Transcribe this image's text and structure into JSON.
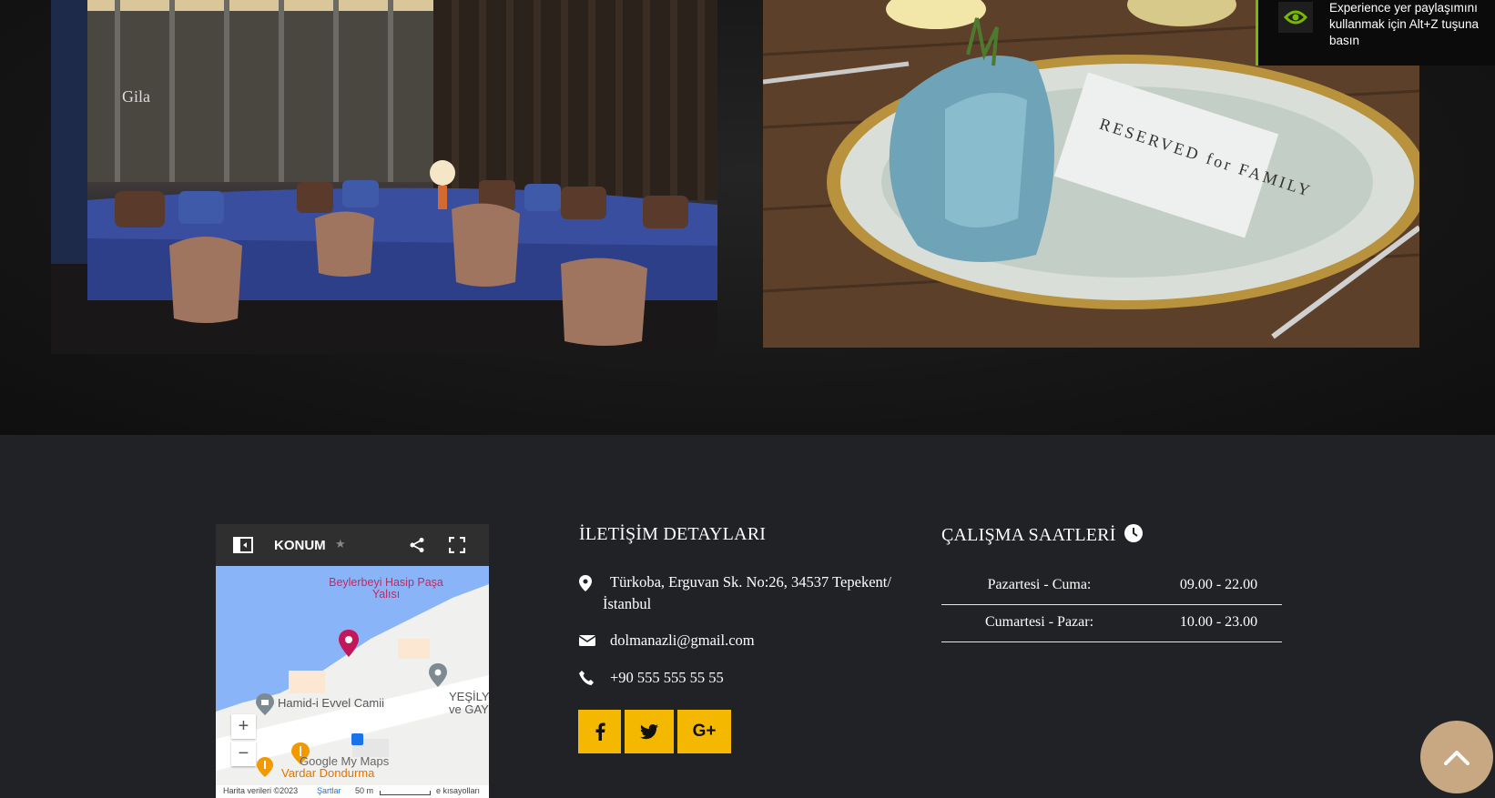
{
  "notification": {
    "text": "Experience yer paylaşımını kullanmak için Alt+Z tuşuna basın"
  },
  "gallery": {
    "images": [
      {
        "name": "lounge-photo",
        "sign_text": "Gila"
      },
      {
        "name": "reserved-table-photo",
        "card_text": "RESERVED for FAMILY"
      }
    ]
  },
  "map": {
    "title": "KONUM",
    "places": [
      {
        "label": "Beylerbeyi Hasip Paşa Yalısı"
      },
      {
        "label": "Hamid-i Evvel Camii"
      },
      {
        "label": "YEŞİLY ve GAY"
      },
      {
        "label": "Vardar Dondurma"
      }
    ],
    "zoom_in": "+",
    "zoom_out": "−",
    "brand": "Google My Maps",
    "footer": {
      "data": "Harita verileri ©2023",
      "terms": "Şartlar",
      "scale": "50 m",
      "shortcuts": "e kısayolları"
    }
  },
  "contact": {
    "heading": "İLETİŞİM DETAYLARI",
    "address_line1": "Türkoba, Erguvan Sk. No:26, 34537 Tepekent/",
    "address_line2": "İstanbul",
    "email": "dolmanazli@gmail.com",
    "phone": "+90 555 555 55 55",
    "social": [
      {
        "name": "facebook",
        "glyph": "f"
      },
      {
        "name": "twitter",
        "glyph": "t"
      },
      {
        "name": "google-plus",
        "glyph": "G+"
      }
    ]
  },
  "hours": {
    "heading": "ÇALIŞMA SAATLERİ",
    "rows": [
      {
        "day": "Pazartesi - Cuma:",
        "time": "09.00 - 22.00"
      },
      {
        "day": "Cumartesi - Pazar:",
        "time": "10.00 - 23.00"
      }
    ]
  },
  "colors": {
    "accent": "#f5b800",
    "footer_bg": "#202226",
    "scroll_top_bg": "#c8a882",
    "nvidia_green": "#76b900"
  }
}
